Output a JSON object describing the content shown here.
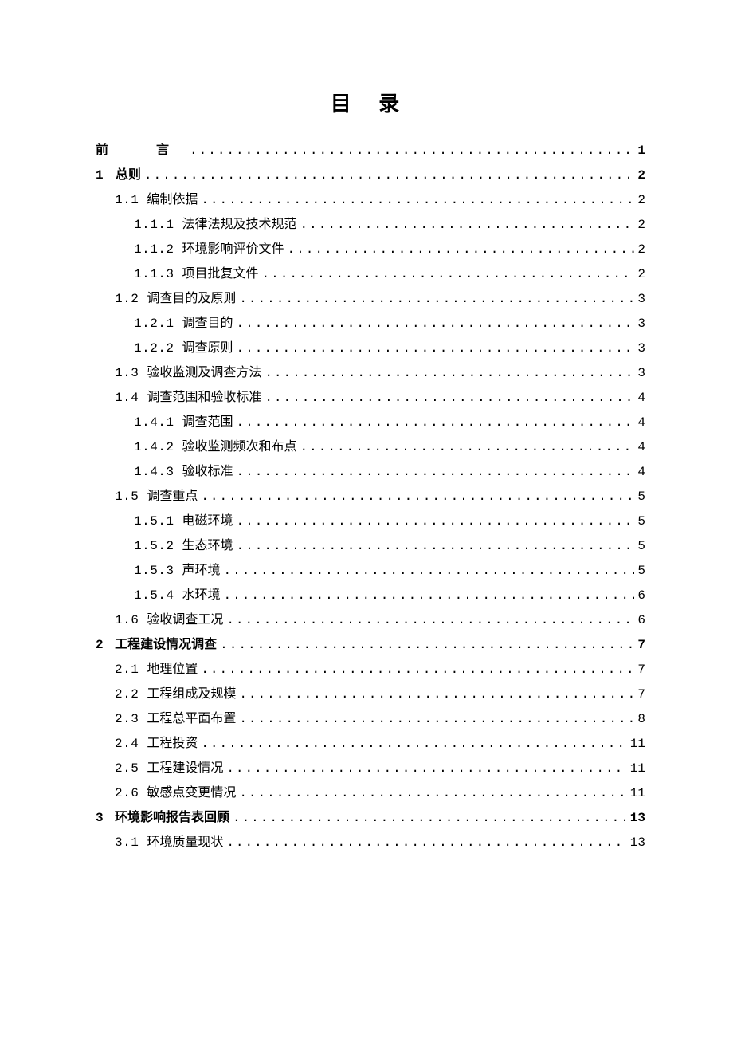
{
  "title": "目 录",
  "entries": [
    {
      "level": 0,
      "num": "",
      "label": "前　言",
      "spaced": true,
      "page": "1"
    },
    {
      "level": 0,
      "num": "1",
      "label": "总则",
      "page": "2"
    },
    {
      "level": 1,
      "num": "1.1",
      "label": "编制依据",
      "page": "2"
    },
    {
      "level": 2,
      "num": "1.1.1",
      "label": "法律法规及技术规范",
      "page": "2"
    },
    {
      "level": 2,
      "num": "1.1.2",
      "label": "环境影响评价文件",
      "page": "2"
    },
    {
      "level": 2,
      "num": "1.1.3",
      "label": "项目批复文件",
      "page": "2"
    },
    {
      "level": 1,
      "num": "1.2",
      "label": "调查目的及原则",
      "page": "3"
    },
    {
      "level": 2,
      "num": "1.2.1",
      "label": "调查目的",
      "page": "3"
    },
    {
      "level": 2,
      "num": "1.2.2",
      "label": "调查原则",
      "page": "3"
    },
    {
      "level": 1,
      "num": "1.3",
      "label": "验收监测及调查方法",
      "page": "3"
    },
    {
      "level": 1,
      "num": "1.4",
      "label": "调查范围和验收标准",
      "page": "4"
    },
    {
      "level": 2,
      "num": "1.4.1",
      "label": "调查范围",
      "page": "4"
    },
    {
      "level": 2,
      "num": "1.4.2",
      "label": "验收监测频次和布点",
      "page": "4"
    },
    {
      "level": 2,
      "num": "1.4.3",
      "label": "验收标准",
      "page": "4"
    },
    {
      "level": 1,
      "num": "1.5",
      "label": "调查重点",
      "page": "5"
    },
    {
      "level": 2,
      "num": "1.5.1",
      "label": "电磁环境",
      "page": "5"
    },
    {
      "level": 2,
      "num": "1.5.2",
      "label": "生态环境",
      "page": "5"
    },
    {
      "level": 2,
      "num": "1.5.3",
      "label": "声环境",
      "page": "5"
    },
    {
      "level": 2,
      "num": "1.5.4",
      "label": "水环境",
      "page": "6"
    },
    {
      "level": 1,
      "num": "1.6",
      "label": "验收调查工况",
      "page": "6"
    },
    {
      "level": 0,
      "num": "2",
      "label": "工程建设情况调查",
      "page": "7"
    },
    {
      "level": 1,
      "num": "2.1",
      "label": "地理位置",
      "page": "7"
    },
    {
      "level": 1,
      "num": "2.2",
      "label": "工程组成及规模",
      "page": "7"
    },
    {
      "level": 1,
      "num": "2.3",
      "label": "工程总平面布置",
      "page": "8"
    },
    {
      "level": 1,
      "num": "2.4",
      "label": "工程投资",
      "page": "11"
    },
    {
      "level": 1,
      "num": "2.5",
      "label": "工程建设情况",
      "page": "11"
    },
    {
      "level": 1,
      "num": "2.6",
      "label": "敏感点变更情况",
      "page": "11"
    },
    {
      "level": 0,
      "num": "3",
      "label": "环境影响报告表回顾",
      "page": "13"
    },
    {
      "level": 1,
      "num": "3.1",
      "label": "环境质量现状",
      "page": "13"
    }
  ]
}
